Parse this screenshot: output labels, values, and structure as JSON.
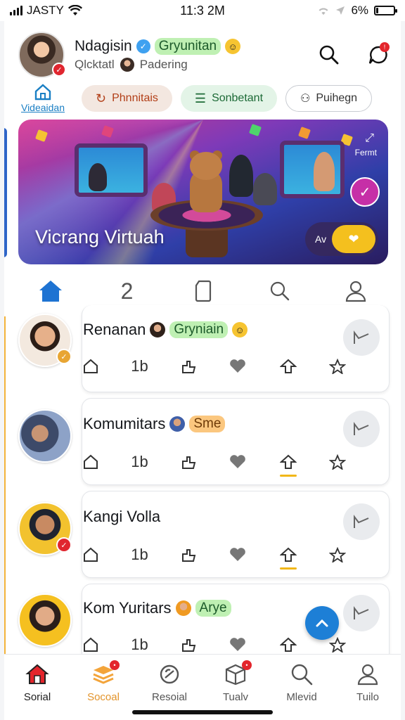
{
  "status_bar": {
    "carrier": "JASTY",
    "time": "11:3 2M",
    "battery": "6%",
    "battery_level": 0.06
  },
  "profile": {
    "name": "Ndagisin",
    "tag": "Gryunitan",
    "subtitle": "Qlcktatl",
    "subtitle_extra": "Padering"
  },
  "quick": {
    "home_label": "Videaidan",
    "chip_orange": "Phnnitais",
    "chip_green": "Sonbetant",
    "chip_white": "Puihegn"
  },
  "banner": {
    "title": "Vicrang Virtuah",
    "corner_text": "Fermt",
    "control_text": "Av"
  },
  "mid_nav": {
    "number": "2"
  },
  "feed": [
    {
      "name": "Renanan",
      "tag": "Gryniain",
      "count": "1b",
      "tag_style": "green"
    },
    {
      "name": "Komumitars",
      "tag": "Sme",
      "count": "1b",
      "tag_style": "orange"
    },
    {
      "name": "Kangi Volla",
      "tag": "",
      "count": "1b",
      "tag_style": "none"
    },
    {
      "name": "Kom Yuritars",
      "tag": "Arye",
      "count": "1b",
      "tag_style": "green"
    }
  ],
  "bottom_nav": [
    {
      "label": "Sorial",
      "icon": "home-icon"
    },
    {
      "label": "Socoal",
      "icon": "layers-icon"
    },
    {
      "label": "Resoial",
      "icon": "link-icon"
    },
    {
      "label": "Tualv",
      "icon": "box-icon"
    },
    {
      "label": "Mlevid",
      "icon": "search-icon"
    },
    {
      "label": "Tuilo",
      "icon": "user-icon"
    }
  ],
  "colors": {
    "accent_blue": "#1d7fd6",
    "accent_orange": "#e3942b",
    "alert_red": "#e3252c"
  }
}
